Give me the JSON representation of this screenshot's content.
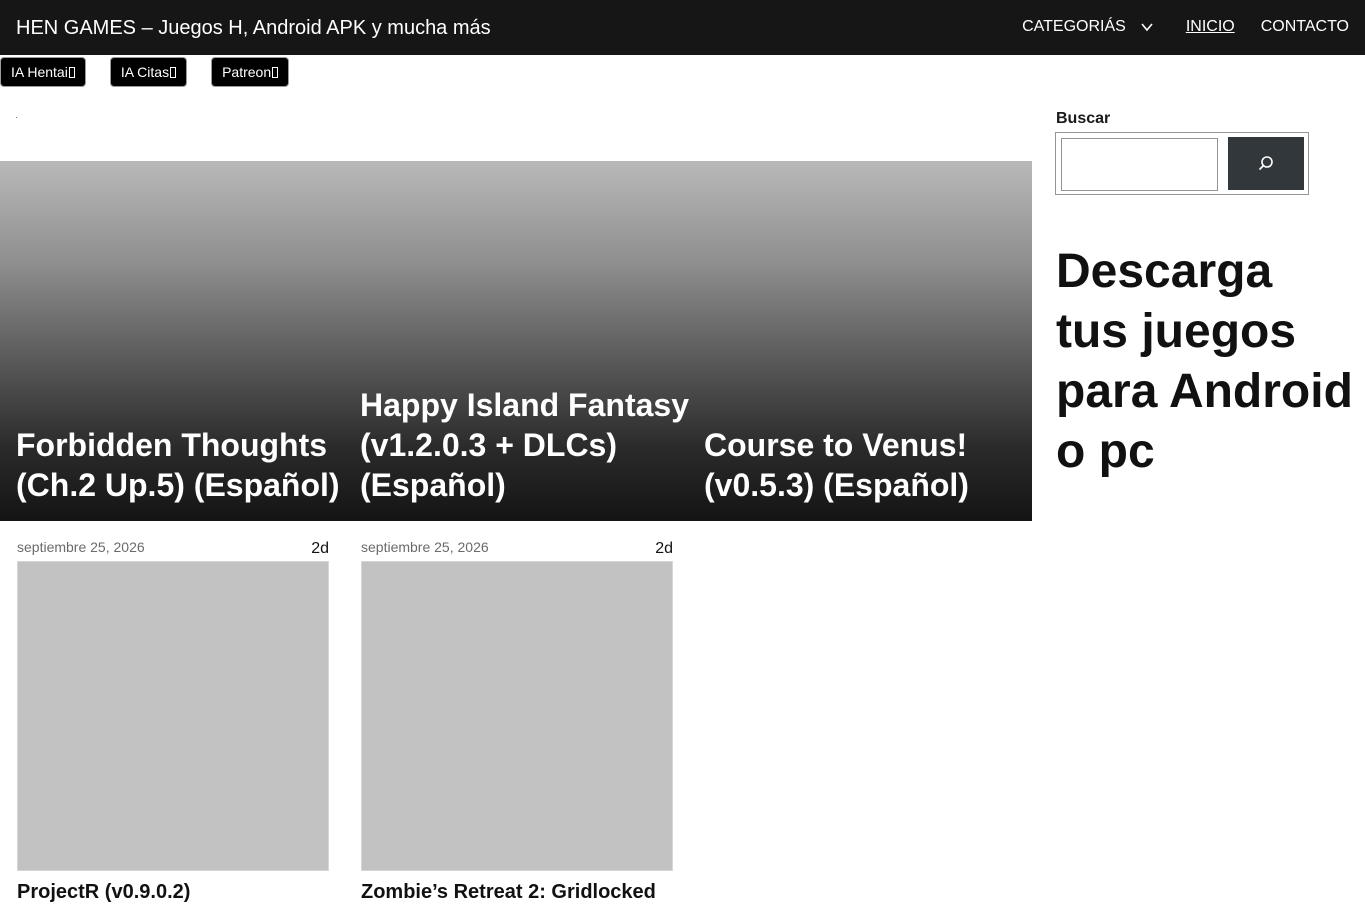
{
  "header": {
    "site_title": "HEN GAMES – Juegos H, Android APK y mucha más",
    "nav": {
      "categories": "CATEGORIÁS",
      "home": "INICIO",
      "contact": "CONTACTO"
    }
  },
  "pills": [
    {
      "label": "IA Hentai",
      "icon": "external-link-icon"
    },
    {
      "label": "IA Citas",
      "icon": "external-link-icon"
    },
    {
      "label": "Patreon",
      "icon": "external-link-icon"
    }
  ],
  "featured": [
    {
      "title": "Forbidden Thoughts (Ch.2 Up.5) (Español)"
    },
    {
      "title": "Happy Island Fantasy (v1.2.0.3 + DLCs) (Español)"
    },
    {
      "title": "Course to Venus! (v0.5.3) (Español)"
    }
  ],
  "posts": [
    {
      "date": "septiembre 25, 2026",
      "ago": "2d",
      "title": "ProjectR (v0.9.0.2)"
    },
    {
      "date": "septiembre 25, 2026",
      "ago": "2d",
      "title": "Zombie’s Retreat 2: Gridlocked"
    }
  ],
  "sidebar": {
    "search_label": "Buscar",
    "search_value": "",
    "tagline": "Descarga tus juegos para Android o pc"
  },
  "colors": {
    "header_bg": "#161616",
    "search_button_bg": "#32373c",
    "thumb_placeholder": "#c2c2c2"
  }
}
